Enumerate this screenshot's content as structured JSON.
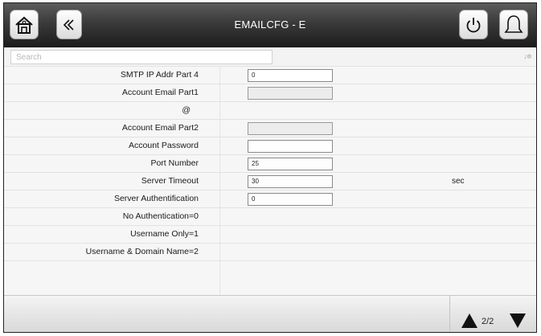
{
  "header": {
    "title": "EMAILCFG - E",
    "home_icon": "home-icon",
    "back_icon": "double-chevron-left-icon",
    "power_icon": "power-icon",
    "alarm_icon": "bell-icon"
  },
  "search": {
    "placeholder": "Search",
    "sort_icon": "sort-icon",
    "sort_glyph": "↓≑"
  },
  "rows": [
    {
      "label": "SMTP IP Addr Part 4",
      "value": "0",
      "unit": ""
    },
    {
      "label": "Account Email Part1",
      "value": "",
      "unit": ""
    },
    {
      "label": "@",
      "value": null,
      "unit": ""
    },
    {
      "label": "Account Email Part2",
      "value": "",
      "unit": ""
    },
    {
      "label": "Account Password",
      "value": "",
      "unit": ""
    },
    {
      "label": "Port Number",
      "value": "25",
      "unit": ""
    },
    {
      "label": "Server Timeout",
      "value": "30",
      "unit": "sec"
    },
    {
      "label": "Server Authentification",
      "value": "0",
      "unit": ""
    },
    {
      "label": "No Authentication=0",
      "value": null,
      "unit": ""
    },
    {
      "label": "Username Only=1",
      "value": null,
      "unit": ""
    },
    {
      "label": "Username & Domain Name=2",
      "value": null,
      "unit": ""
    }
  ],
  "footer": {
    "page_indicator": "2/2",
    "up_icon": "triangle-up-icon",
    "down_icon": "triangle-down-icon"
  }
}
